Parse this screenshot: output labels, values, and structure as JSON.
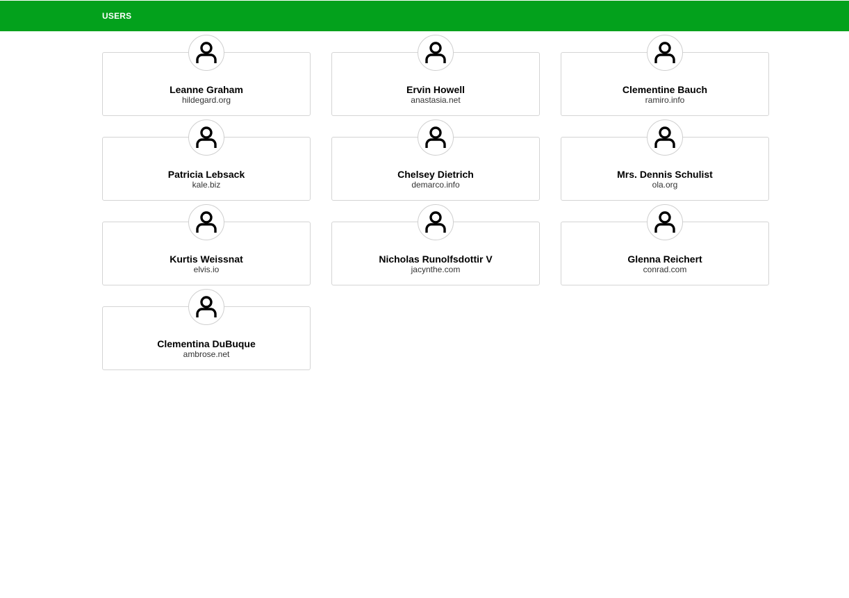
{
  "header": {
    "title": "USERS",
    "background_color": "#03a11c"
  },
  "avatar_icon": "user-silhouette-icon",
  "users": [
    {
      "name": "Leanne Graham",
      "website": "hildegard.org"
    },
    {
      "name": "Ervin Howell",
      "website": "anastasia.net"
    },
    {
      "name": "Clementine Bauch",
      "website": "ramiro.info"
    },
    {
      "name": "Patricia Lebsack",
      "website": "kale.biz"
    },
    {
      "name": "Chelsey Dietrich",
      "website": "demarco.info"
    },
    {
      "name": "Mrs. Dennis Schulist",
      "website": "ola.org"
    },
    {
      "name": "Kurtis Weissnat",
      "website": "elvis.io"
    },
    {
      "name": "Nicholas Runolfsdottir V",
      "website": "jacynthe.com"
    },
    {
      "name": "Glenna Reichert",
      "website": "conrad.com"
    },
    {
      "name": "Clementina DuBuque",
      "website": "ambrose.net"
    }
  ]
}
